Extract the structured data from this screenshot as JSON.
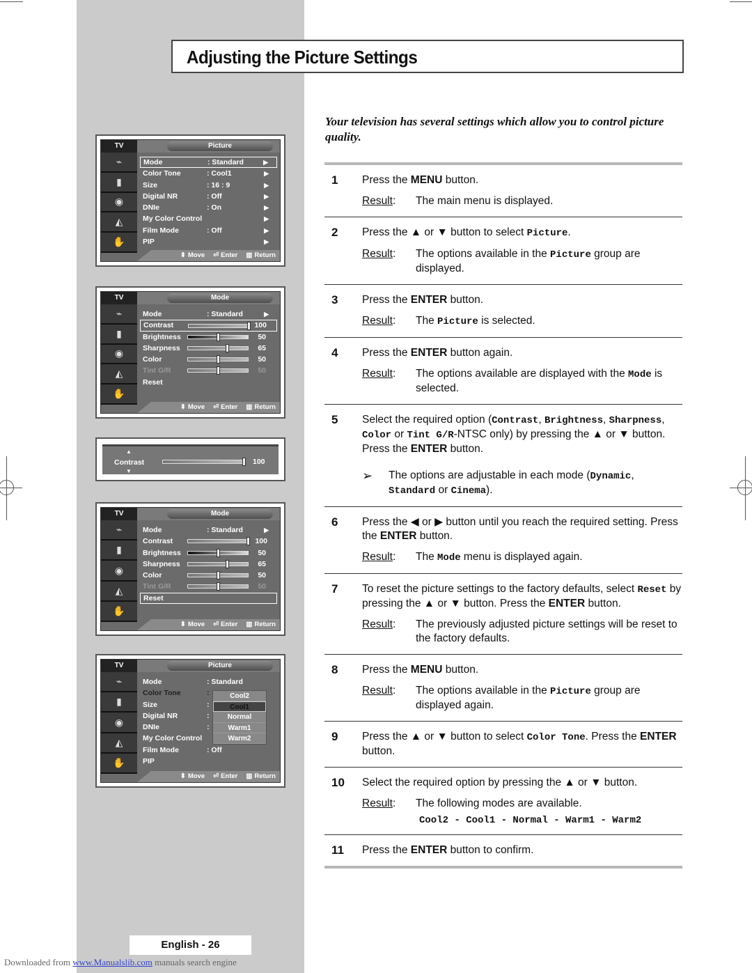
{
  "page": {
    "title": "Adjusting the Picture Settings",
    "intro": "Your television has several settings which allow you to control picture quality.",
    "page_label": "English - 26",
    "footer": {
      "prefix": "Downloaded from",
      "link": "www.Manualslib.com",
      "suffix": "manuals search engine"
    }
  },
  "result_label": "Result",
  "steps": [
    {
      "num": "1",
      "text_html": "Press the <b>MENU</b> button.",
      "result_html": "The main menu is displayed."
    },
    {
      "num": "2",
      "text_html": "Press the ▲ or ▼ button to select <span class=\"mono\">Picture</span>.",
      "result_html": "The options available in the <span class=\"mono\">Picture</span> group are displayed."
    },
    {
      "num": "3",
      "text_html": "Press the <b>ENTER</b> button.",
      "result_html": "The <span class=\"mono\">Picture</span> is selected."
    },
    {
      "num": "4",
      "text_html": "Press the <b>ENTER</b> button again.",
      "result_html": "The options available are displayed with the <span class=\"mono\">Mode</span> is selected."
    },
    {
      "num": "5",
      "text_html": "Select the required option (<span class=\"mono\">Contrast</span>, <span class=\"mono\">Brightness</span>, <span class=\"mono\">Sharpness</span>, <span class=\"mono\">Color</span> or <span class=\"mono\">Tint G/R</span>-NTSC only) by pressing the ▲ or ▼ button. Press the <b>ENTER</b> button.",
      "note_html": "The options are adjustable in each mode (<span class=\"mono\">Dynamic</span>, <span class=\"mono\">Standard</span> or <span class=\"mono\">Cinema</span>)."
    },
    {
      "num": "6",
      "text_html": "Press the ◀ or ▶ button until you reach the required setting. Press the <b>ENTER</b> button.",
      "result_html": "The <span class=\"mono\">Mode</span> menu is displayed again."
    },
    {
      "num": "7",
      "text_html": "To reset the picture settings to the factory defaults, select <span class=\"mono\">Reset</span> by pressing the ▲ or ▼ button. Press the <b>ENTER</b> button.",
      "result_html": "The previously adjusted picture settings will be reset to the factory defaults."
    },
    {
      "num": "8",
      "text_html": "Press the <b>MENU</b> button.",
      "result_html": "The options available in the <span class=\"mono\">Picture</span> group are displayed again."
    },
    {
      "num": "9",
      "text_html": "Press the ▲ or ▼ button to select <span class=\"mono\">Color Tone</span>. Press the <b>ENTER</b> button."
    },
    {
      "num": "10",
      "text_html": "Select the required option by pressing the ▲ or ▼ button.",
      "result_html": "The following modes are available.",
      "modes": "Cool2 - Cool1 - Normal - Warm1 - Warm2"
    },
    {
      "num": "11",
      "text_html": "Press the <b>ENTER</b> button to confirm."
    }
  ],
  "osd_common": {
    "tv_label": "TV",
    "footer": {
      "move": "Move",
      "enter": "Enter",
      "return": "Return"
    },
    "side_icons": [
      "input-icon",
      "picture-icon",
      "sound-icon",
      "channel-icon",
      "setup-icon"
    ]
  },
  "osd1": {
    "tab": "Picture",
    "rows": [
      {
        "label": "Mode",
        "value": ": Standard",
        "arrow": true,
        "selected": true
      },
      {
        "label": "Color Tone",
        "value": ": Cool1",
        "arrow": true
      },
      {
        "label": "Size",
        "value": ": 16 : 9",
        "arrow": true
      },
      {
        "label": "Digital NR",
        "value": ": Off",
        "arrow": true
      },
      {
        "label": "DNIe",
        "value": ": On",
        "arrow": true
      },
      {
        "label": "My Color Control",
        "value": "",
        "arrow": true
      },
      {
        "label": "Film Mode",
        "value": ": Off",
        "arrow": true
      },
      {
        "label": "PIP",
        "value": "",
        "arrow": true
      }
    ]
  },
  "osd2": {
    "tab": "Mode",
    "selected_index": 1,
    "mode_label": "Mode",
    "mode_value": ": Standard",
    "sliders": [
      {
        "label": "Contrast",
        "value": 100
      },
      {
        "label": "Brightness",
        "value": 50
      },
      {
        "label": "Sharpness",
        "value": 65
      },
      {
        "label": "Color",
        "value": 50
      },
      {
        "label": "Tint G/R",
        "value": 50,
        "disabled": true
      }
    ],
    "reset_label": "Reset"
  },
  "contrast_adjust": {
    "label": "Contrast",
    "value": 100
  },
  "osd3": {
    "tab": "Mode",
    "selected_index": 6,
    "mode_label": "Mode",
    "mode_value": ": Standard",
    "sliders": [
      {
        "label": "Contrast",
        "value": 100
      },
      {
        "label": "Brightness",
        "value": 50
      },
      {
        "label": "Sharpness",
        "value": 65
      },
      {
        "label": "Color",
        "value": 50
      },
      {
        "label": "Tint G/R",
        "value": 50,
        "disabled": true
      }
    ],
    "reset_label": "Reset"
  },
  "osd4": {
    "tab": "Picture",
    "rows": [
      {
        "label": "Mode",
        "value": ": Standard"
      },
      {
        "label": "Color Tone",
        "value": ":",
        "dark": true
      },
      {
        "label": "Size",
        "value": ":"
      },
      {
        "label": "Digital NR",
        "value": ":"
      },
      {
        "label": "DNIe",
        "value": ":"
      },
      {
        "label": "My Color Control",
        "value": ""
      },
      {
        "label": "Film Mode",
        "value": ": Off"
      },
      {
        "label": "PIP",
        "value": ""
      }
    ],
    "popup_options": [
      "Cool2",
      "Cool1",
      "Normal",
      "Warm1",
      "Warm2"
    ],
    "popup_selected": "Cool1"
  }
}
